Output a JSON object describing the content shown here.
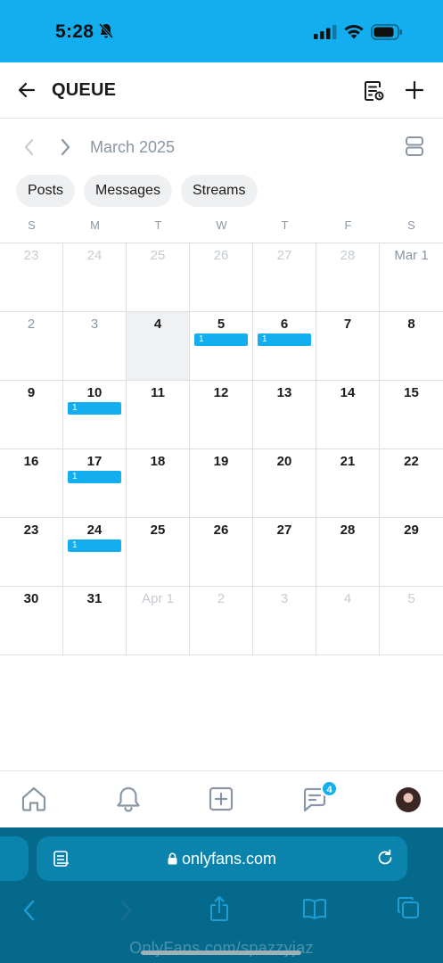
{
  "status_bar": {
    "time": "5:28"
  },
  "header": {
    "title": "QUEUE"
  },
  "calendar": {
    "month_label": "March 2025",
    "weekdays": [
      "S",
      "M",
      "T",
      "W",
      "T",
      "F",
      "S"
    ],
    "weeks": [
      [
        {
          "label": "23",
          "state": "other"
        },
        {
          "label": "24",
          "state": "other"
        },
        {
          "label": "25",
          "state": "other"
        },
        {
          "label": "26",
          "state": "other"
        },
        {
          "label": "27",
          "state": "other"
        },
        {
          "label": "28",
          "state": "other"
        },
        {
          "label": "Mar 1",
          "state": "past"
        }
      ],
      [
        {
          "label": "2",
          "state": "past"
        },
        {
          "label": "3",
          "state": "past"
        },
        {
          "label": "4",
          "state": "today"
        },
        {
          "label": "5",
          "state": "current",
          "event": "1"
        },
        {
          "label": "6",
          "state": "current",
          "event": "1"
        },
        {
          "label": "7",
          "state": "current"
        },
        {
          "label": "8",
          "state": "current"
        }
      ],
      [
        {
          "label": "9",
          "state": "current"
        },
        {
          "label": "10",
          "state": "current",
          "event": "1"
        },
        {
          "label": "11",
          "state": "current"
        },
        {
          "label": "12",
          "state": "current"
        },
        {
          "label": "13",
          "state": "current"
        },
        {
          "label": "14",
          "state": "current"
        },
        {
          "label": "15",
          "state": "current"
        }
      ],
      [
        {
          "label": "16",
          "state": "current"
        },
        {
          "label": "17",
          "state": "current",
          "event": "1"
        },
        {
          "label": "18",
          "state": "current"
        },
        {
          "label": "19",
          "state": "current"
        },
        {
          "label": "20",
          "state": "current"
        },
        {
          "label": "21",
          "state": "current"
        },
        {
          "label": "22",
          "state": "current"
        }
      ],
      [
        {
          "label": "23",
          "state": "current"
        },
        {
          "label": "24",
          "state": "current",
          "event": "1"
        },
        {
          "label": "25",
          "state": "current"
        },
        {
          "label": "26",
          "state": "current"
        },
        {
          "label": "27",
          "state": "current"
        },
        {
          "label": "28",
          "state": "current"
        },
        {
          "label": "29",
          "state": "current"
        }
      ],
      [
        {
          "label": "30",
          "state": "current"
        },
        {
          "label": "31",
          "state": "current"
        },
        {
          "label": "Apr 1",
          "state": "other"
        },
        {
          "label": "2",
          "state": "other"
        },
        {
          "label": "3",
          "state": "other"
        },
        {
          "label": "4",
          "state": "other"
        },
        {
          "label": "5",
          "state": "other"
        }
      ]
    ]
  },
  "filters": [
    "Posts",
    "Messages",
    "Streams"
  ],
  "bottom_nav": {
    "items": [
      "home-icon",
      "bell-icon",
      "add-post-icon",
      "messages-icon",
      "avatar"
    ],
    "messages_badge": "4"
  },
  "browser": {
    "url": "onlyfans.com",
    "watermark": "OnlyFans.com/spazzyjaz"
  },
  "colors": {
    "accent": "#12aef0",
    "status_bar": "#12aef0",
    "safari_bar": "#05698c",
    "muted_text": "#8a96a3"
  }
}
